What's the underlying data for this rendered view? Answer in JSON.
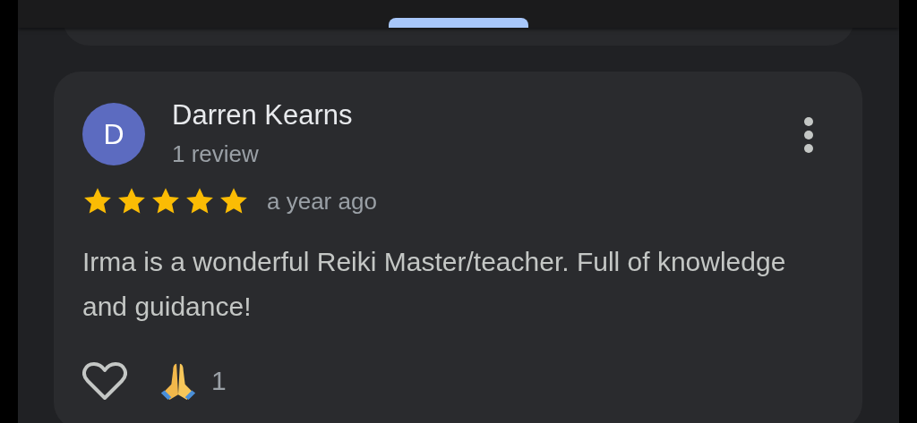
{
  "review": {
    "avatar_letter": "D",
    "author": "Darren Kearns",
    "author_meta": "1 review",
    "stars": 5,
    "time": "a year ago",
    "text": "Irma is a wonderful Reiki Master/teacher. Full of knowledge and guidance!",
    "liked": false,
    "reaction_count": "1"
  }
}
